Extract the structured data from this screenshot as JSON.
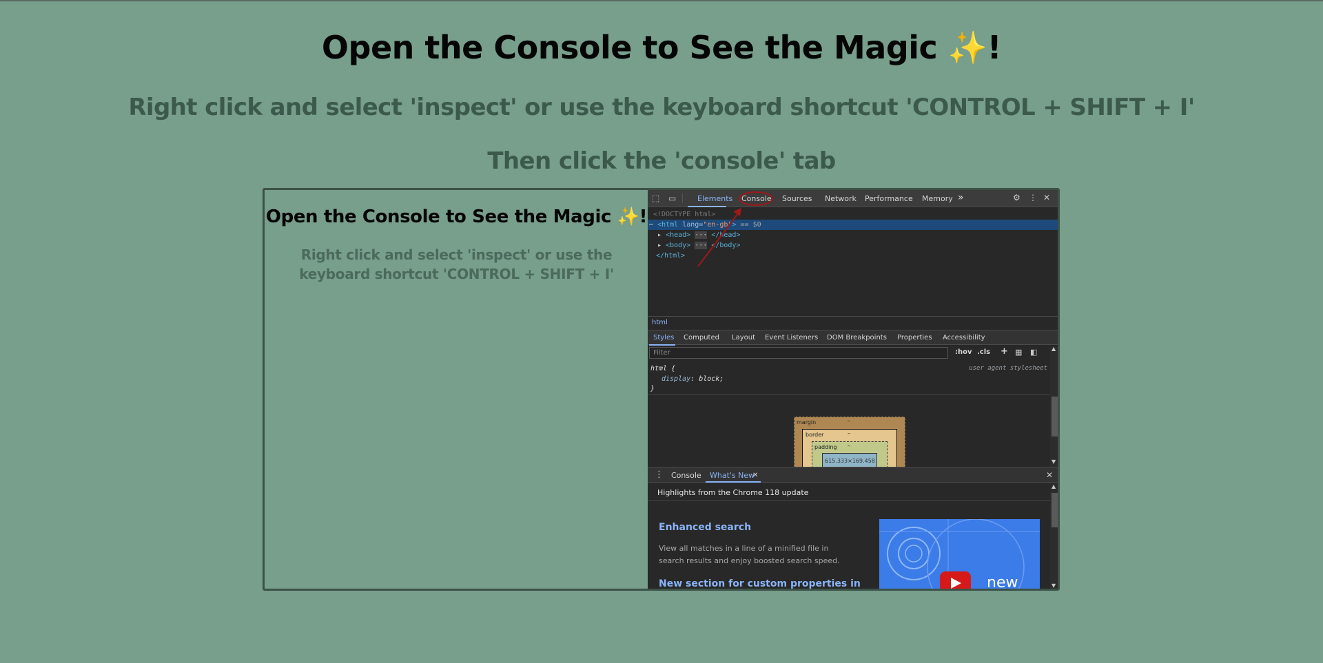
{
  "page": {
    "title": "Open the Console to See the Magic ✨!",
    "subtitle": "Right click and select 'inspect' or use the keyboard shortcut 'CONTROL + SHIFT + I'",
    "subtitle2": "Then click the 'console' tab"
  },
  "preview": {
    "title": "Open the Console to See the Magic ✨!",
    "subtitle": "Right click and select 'inspect' or use the keyboard shortcut 'CONTROL + SHIFT + I'"
  },
  "devtools": {
    "tabs": [
      "Elements",
      "Console",
      "Sources",
      "Network",
      "Performance",
      "Memory"
    ],
    "more_tabs": "»",
    "dom": {
      "doctype": "<!DOCTYPE html>",
      "html_open_tag": "<html",
      "html_attr": "lang=",
      "html_attr_val": "\"en-gb\"",
      "html_close_bracket": ">",
      "selected_suffix": "== $0",
      "head": "<head>",
      "head_ellipsis": "···",
      "head_close": "</head>",
      "body": "<body>",
      "body_ellipsis": "···",
      "body_close": "</body>",
      "html_close": "</html>"
    },
    "breadcrumb": "html",
    "subtabs": [
      "Styles",
      "Computed",
      "Layout",
      "Event Listeners",
      "DOM Breakpoints",
      "Properties",
      "Accessibility"
    ],
    "filter_placeholder": "Filter",
    "filter_options": [
      ":hov",
      ".cls",
      "+"
    ],
    "css": {
      "selector": "html {",
      "property": "display",
      "value": "block;",
      "close": "}",
      "source": "user agent stylesheet"
    },
    "box_model": {
      "margin": "margin",
      "border": "border",
      "padding": "padding",
      "dash": "–",
      "content": "615.333×169.458"
    },
    "drawer": {
      "tabs": [
        "Console",
        "What's New"
      ],
      "whats_new_close": "✕",
      "header": "Highlights from the Chrome 118 update",
      "item1_title": "Enhanced search",
      "item1_body": "View all matches in a line of a minified file in search results and enjoy boosted search speed.",
      "item2_title": "New section for custom properties in",
      "thumb_label": "new"
    }
  },
  "colors": {
    "page_bg": "#789e8c",
    "devtools_bg": "#282828",
    "accent": "#8ab4f8",
    "annotation": "#a01818"
  }
}
